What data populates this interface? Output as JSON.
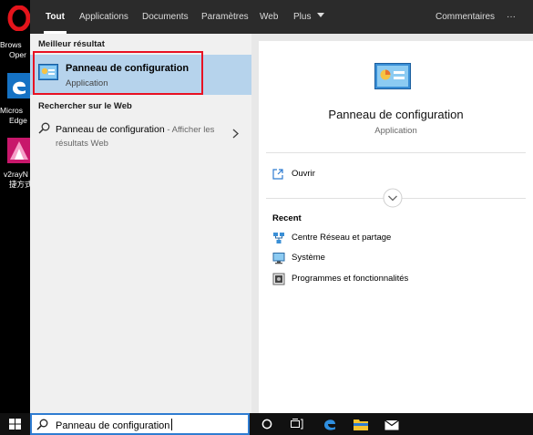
{
  "desktop": {
    "icons": [
      {
        "label_line1": "Brows",
        "label_line2": "Oper",
        "icon": "opera-icon"
      },
      {
        "label_line1": "Micros",
        "label_line2": "Edge",
        "icon": "edge-icon"
      },
      {
        "label_line1": "v2rayN",
        "label_line2": "捷方式",
        "icon": "v2rayn-icon"
      }
    ]
  },
  "tabs": {
    "all": "Tout",
    "apps": "Applications",
    "documents": "Documents",
    "settings": "Paramètres",
    "web": "Web",
    "more": "Plus",
    "feedback": "Commentaires",
    "options": "···"
  },
  "best_match": {
    "heading": "Meilleur résultat",
    "title": "Panneau de configuration",
    "subtitle": "Application"
  },
  "web_search": {
    "heading": "Rechercher sur le Web",
    "query": "Panneau de configuration",
    "suffix": " - Afficher les résultats Web"
  },
  "preview": {
    "title": "Panneau de configuration",
    "subtitle": "Application",
    "open_label": "Ouvrir",
    "recent_heading": "Recent",
    "recent_items": [
      {
        "label": "Centre Réseau et partage",
        "icon": "network-icon"
      },
      {
        "label": "Système",
        "icon": "monitor-icon"
      },
      {
        "label": "Programmes et fonctionnalités",
        "icon": "programs-icon"
      }
    ]
  },
  "taskbar": {
    "search_value": "Panneau de configuration"
  },
  "colors": {
    "selected": "#b6d3ec",
    "highlight_border": "#e81123",
    "accent": "#2f7cd1"
  }
}
